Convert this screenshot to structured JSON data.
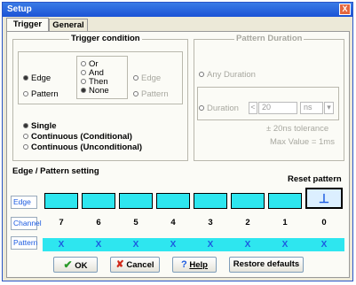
{
  "window": {
    "title": "Setup",
    "close_glyph": "X"
  },
  "tabs": [
    {
      "label": "Trigger"
    },
    {
      "label": "General"
    }
  ],
  "trigger_condition": {
    "title": "Trigger condition",
    "type_options": [
      "Edge",
      "Pattern"
    ],
    "type_selected": "Edge",
    "logic_options": [
      "Or",
      "And",
      "Then",
      "None"
    ],
    "logic_selected": "None",
    "disabled_options": [
      "Edge",
      "Pattern"
    ]
  },
  "mode": {
    "options": [
      "Single",
      "Continuous (Conditional)",
      "Continuous (Unconditional)"
    ],
    "selected": "Single"
  },
  "pattern_duration": {
    "title": "Pattern Duration",
    "any_label": "Any Duration",
    "duration_label": "Duration",
    "duration_value": "20",
    "unit": "ns",
    "tolerance_text": "± 20ns tolerance",
    "max_text": "Max Value = 1ms"
  },
  "edge_pattern": {
    "title": "Edge / Pattern setting",
    "reset_label": "Reset pattern",
    "row_labels": {
      "edge": "Edge",
      "channel": "Channel",
      "pattern": "Pattern"
    },
    "channels": [
      "7",
      "6",
      "5",
      "4",
      "3",
      "2",
      "1",
      "0"
    ],
    "patterns": [
      "X",
      "X",
      "X",
      "X",
      "X",
      "X",
      "X",
      "X"
    ],
    "edge_symbol": "⊥",
    "colors": {
      "cell": "#2ee6ef",
      "label_text": "#1c5be0"
    }
  },
  "buttons": {
    "ok": "OK",
    "cancel": "Cancel",
    "help": "Help",
    "restore": "Restore defaults"
  },
  "icons": {
    "ok": "check-icon",
    "cancel": "cross-icon",
    "help": "question-icon"
  }
}
